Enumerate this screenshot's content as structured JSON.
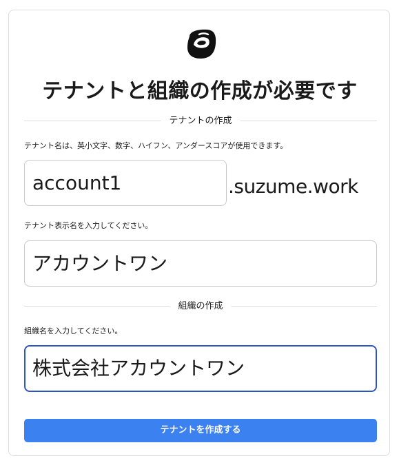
{
  "logo": {
    "icon": "suzume-logo-icon"
  },
  "title": "テナントと組織の作成が必要です",
  "tenant_section": {
    "heading": "テナントの作成",
    "name_hint": "テナント名は、英小文字、数字、ハイフン、アンダースコアが使用できます。",
    "name_value": "account1",
    "domain_suffix": ".suzume.work",
    "display_name_hint": "テナント表示名を入力してください。",
    "display_name_value": "アカウントワン"
  },
  "org_section": {
    "heading": "組織の作成",
    "name_hint": "組織名を入力してください。",
    "name_value": "株式会社アカウントワン"
  },
  "submit": {
    "label": "テナントを作成する"
  },
  "colors": {
    "primary_button": "#3b82f0",
    "focus_border": "#2f55c4",
    "border": "#dddddd"
  }
}
